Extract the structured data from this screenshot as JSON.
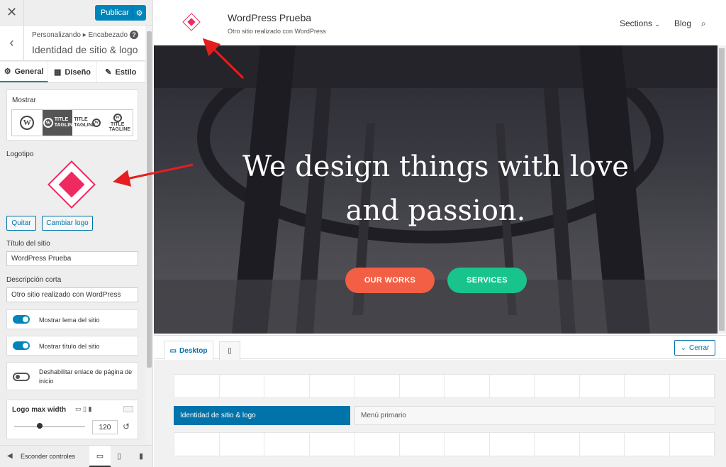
{
  "sidebar": {
    "close_icon": "close-icon",
    "publish_label": "Publicar",
    "breadcrumb_path": "Personalizando ▸ Encabezado",
    "section_title": "Identidad de sitio & logo",
    "tabs": [
      {
        "label": "General",
        "icon": "gear-icon",
        "active": true
      },
      {
        "label": "Diseño",
        "icon": "layout-icon",
        "active": false
      },
      {
        "label": "Estilo",
        "icon": "brush-icon",
        "active": false
      }
    ],
    "show_label": "Mostrar",
    "show_options": [
      {
        "text": "W",
        "selected": false
      },
      {
        "text": "TITLE TAGLINE",
        "selected": true
      },
      {
        "text": "TITLE TAGLINE",
        "selected": false
      },
      {
        "text": "TITLE TAGLINE",
        "selected": false
      }
    ],
    "logo_label": "Logotipo",
    "remove_button": "Quitar",
    "change_logo_button": "Cambiar logo",
    "site_title_label": "Título del sitio",
    "site_title_value": "WordPress Prueba",
    "short_desc_label": "Descripción corta",
    "short_desc_value": "Otro sitio realizado con WordPress",
    "toggles": [
      {
        "label": "Mostrar lema del sitio",
        "on": true
      },
      {
        "label": "Mostrar título del sitio",
        "on": true
      },
      {
        "label": "Deshabilitar enlace de página de inicio",
        "on": false
      }
    ],
    "logo_max_width_label": "Logo max width",
    "logo_max_width_value": "120",
    "hide_controls_label": "Esconder controles"
  },
  "preview": {
    "site_title": "WordPress Prueba",
    "site_description": "Otro sitio realizado con WordPress",
    "nav": [
      "Sections",
      "Blog"
    ],
    "hero_heading": "We design things with love and passion.",
    "cta_primary": "OUR WORKS",
    "cta_secondary": "SERVICES",
    "colors": {
      "brand": "#ee2a61",
      "primary_cta": "#f25f45",
      "secondary_cta": "#19c48c",
      "wp_blue": "#0085ba"
    }
  },
  "device_bar": {
    "desktop_label": "Desktop",
    "close_label": "Cerrar"
  },
  "menu_builder": {
    "active_item": "Identidad de sitio & logo",
    "other_item": "Menú primario"
  }
}
